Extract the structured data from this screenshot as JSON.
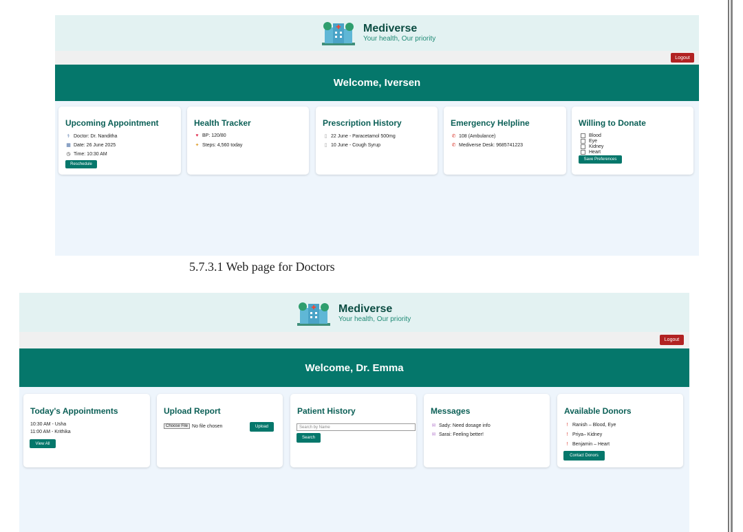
{
  "doctor_page": {
    "brand": {
      "name": "Mediverse",
      "tagline": "Your health, Our priority"
    },
    "logout_label": "Logout",
    "welcome": "Welcome, Iversen",
    "cards": {
      "appointment": {
        "title": "Upcoming Appointment",
        "doctor": "Doctor: Dr. Nanditha",
        "date": "Date: 26 June 2025",
        "time": "Time: 10:30 AM",
        "button": "Reschedule"
      },
      "health": {
        "title": "Health Tracker",
        "bp": "BP: 120/80",
        "steps": "Steps: 4,560 today"
      },
      "prescription": {
        "title": "Prescription History",
        "items": [
          "22 June - Paracetamol 500mg",
          "10 June - Cough Syrup"
        ]
      },
      "emergency": {
        "title": "Emergency Helpline",
        "items": [
          "108 (Ambulance)",
          "Mediverse Desk: 9685741223"
        ]
      },
      "donate": {
        "title": "Willing to Donate",
        "options": [
          "Blood",
          "Eye",
          "Kidney",
          "Heart"
        ],
        "button": "Save Preferences"
      }
    }
  },
  "caption": "5.7.3.1 Web page for Doctors",
  "patient_page": {
    "brand": {
      "name": "Mediverse",
      "tagline": "Your health, Our priority"
    },
    "logout_label": "Logout",
    "welcome": "Welcome, Dr. Emma",
    "cards": {
      "appointments": {
        "title": "Today's Appointments",
        "items": [
          "10:30 AM - Usha",
          "11:00 AM - Krithika"
        ],
        "button": "View All"
      },
      "upload": {
        "title": "Upload Report",
        "choose_label": "Choose File",
        "file_status": "No file chosen",
        "button": "Upload"
      },
      "history": {
        "title": "Patient History",
        "placeholder": "Search by Name",
        "button": "Search"
      },
      "messages": {
        "title": "Messages",
        "items": [
          "Sady: Need dosage info",
          "Sarai: Feeling better!"
        ]
      },
      "donors": {
        "title": "Available Donors",
        "items": [
          "Ranish – Blood, Eye",
          "Priya– Kidney",
          "Benjamin – Heart"
        ],
        "button": "Contact Donors"
      }
    }
  },
  "icons": [
    "hospital-logo-icon",
    "doctor-icon",
    "calendar-icon",
    "clock-icon",
    "heart-icon",
    "walking-icon",
    "document-icon",
    "phone-icon",
    "checkbox-icon",
    "envelope-icon",
    "blood-drop-icon"
  ],
  "colors": {
    "primary": "#05776b",
    "logout": "#b22222",
    "header_bg": "#e3f2f2",
    "page_bg": "#eef5fc",
    "title": "#0b5f56"
  }
}
